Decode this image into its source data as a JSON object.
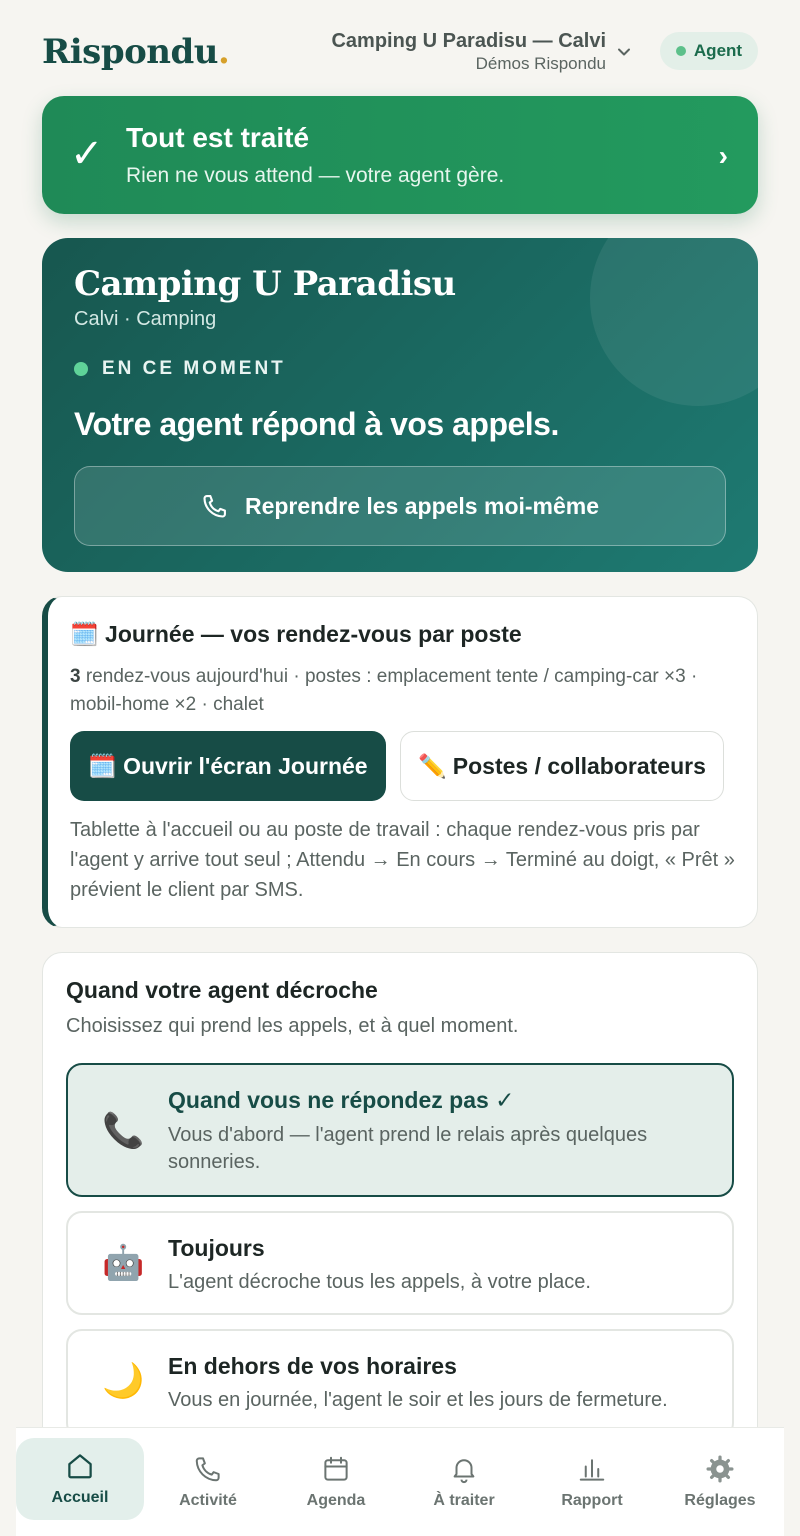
{
  "header": {
    "logo": "Rispondu",
    "logo_dot": ".",
    "org_name": "Camping U Paradisu — Calvi",
    "org_sub": "Démos Rispondu",
    "agent_label": "Agent"
  },
  "status": {
    "check": "✓",
    "title": "Tout est traité",
    "subtitle": "Rien ne vous attend — votre agent gère.",
    "arrow": "›"
  },
  "hero": {
    "title": "Camping U Paradisu",
    "subtitle": "Calvi · Camping",
    "live_label": "EN CE MOMENT",
    "headline": "Votre agent répond à vos appels.",
    "button_label": "Reprendre les appels moi-même"
  },
  "day": {
    "icon": "🗓️",
    "title": "Journée — vos rendez-vous par poste",
    "meta_count": "3",
    "meta_text": " rendez-vous aujourd'hui · postes : emplacement tente / camping-car ×3 · mobil-home ×2 · chalet",
    "open_icon": "🗓️",
    "open_label": "Ouvrir l'écran Journée",
    "postes_icon": "✏️",
    "postes_label": "Postes / collaborateurs",
    "note": "Tablette à l'accueil ou au poste de travail : chaque rendez-vous pris par l'agent y arrive tout seul ; Attendu → En cours → Terminé au doigt, « Prêt » prévient le client par SMS."
  },
  "when": {
    "title": "Quand votre agent décroche",
    "subtitle": "Choisissez qui prend les appels, et à quel moment.",
    "options": [
      {
        "icon": "📞",
        "title": "Quand vous ne répondez pas ✓",
        "desc": "Vous d'abord — l'agent prend le relais après quelques sonneries.",
        "selected": true
      },
      {
        "icon": "🤖",
        "title": "Toujours",
        "desc": "L'agent décroche tous les appels, à votre place.",
        "selected": false
      },
      {
        "icon": "🌙",
        "title": "En dehors de vos horaires",
        "desc": "Vous en journée, l'agent le soir et les jours de fermeture.",
        "selected": false
      }
    ]
  },
  "nav": {
    "items": [
      {
        "label": "Accueil",
        "icon": "home-icon",
        "active": true
      },
      {
        "label": "Activité",
        "icon": "phone-icon",
        "active": false
      },
      {
        "label": "Agenda",
        "icon": "calendar-icon",
        "active": false
      },
      {
        "label": "À traiter",
        "icon": "bell-icon",
        "active": false
      },
      {
        "label": "Rapport",
        "icon": "bar-chart-icon",
        "active": false
      },
      {
        "label": "Réglages",
        "icon": "gear-icon",
        "active": false
      }
    ]
  },
  "colors": {
    "brand": "#174c46",
    "success": "#239a5e",
    "accent": "#d6a02a",
    "background": "#f6f5f1"
  }
}
